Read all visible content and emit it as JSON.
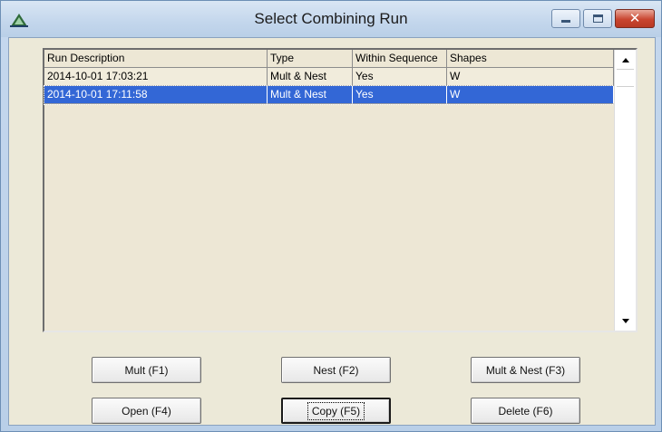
{
  "window": {
    "title": "Select Combining Run"
  },
  "table": {
    "columns": [
      "Run Description",
      "Type",
      "Within Sequence",
      "Shapes"
    ],
    "rows": [
      {
        "description": "2014-10-01 17:03:21",
        "type": "Mult & Nest",
        "within_sequence": "Yes",
        "shapes": "W",
        "selected": false
      },
      {
        "description": "2014-10-01 17:11:58",
        "type": "Mult & Nest",
        "within_sequence": "Yes",
        "shapes": "W",
        "selected": true
      }
    ],
    "selection_color": "#3367d6"
  },
  "buttons": {
    "mult": "Mult (F1)",
    "nest": "Nest (F2)",
    "mult_nest": "Mult & Nest (F3)",
    "open": "Open (F4)",
    "copy": "Copy (F5)",
    "delete": "Delete (F6)"
  },
  "icons": {
    "app": "triangle-logo-icon",
    "minimize": "minimize-icon",
    "maximize": "maximize-icon",
    "close": "close-icon",
    "scroll_up": "arrow-up-icon",
    "scroll_down": "arrow-down-icon"
  }
}
